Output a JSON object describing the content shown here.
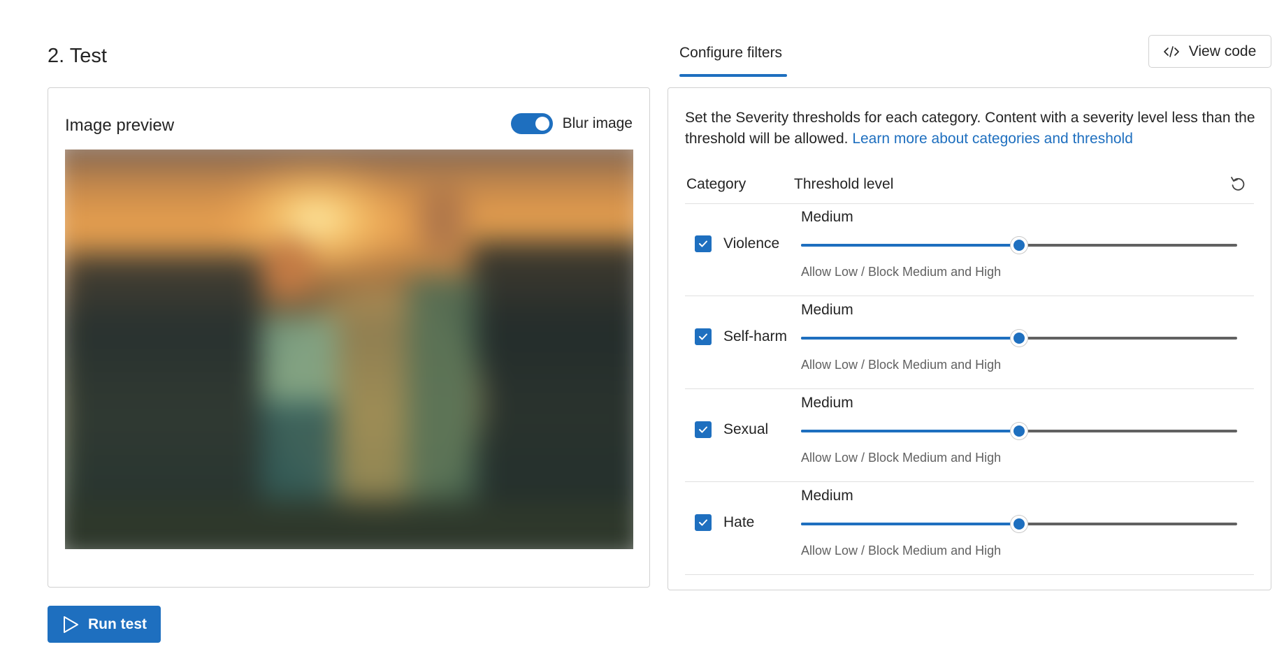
{
  "section": {
    "title": "2. Test"
  },
  "preview": {
    "title": "Image preview",
    "blur_label": "Blur image",
    "blur_enabled": true
  },
  "tabs": [
    {
      "label": "Configure filters",
      "selected": true
    }
  ],
  "view_code_label": "View code",
  "filters": {
    "description": "Set the Severity thresholds for each category. Content with a severity level less than the threshold will be allowed.",
    "learn_more_link": "Learn more about categories and threshold",
    "header": {
      "category": "Category",
      "threshold": "Threshold level"
    },
    "rows": [
      {
        "category": "Violence",
        "checked": true,
        "level": "Medium",
        "hint": "Allow Low / Block Medium and High",
        "value_fraction": 0.5
      },
      {
        "category": "Self-harm",
        "checked": true,
        "level": "Medium",
        "hint": "Allow Low / Block Medium and High",
        "value_fraction": 0.5
      },
      {
        "category": "Sexual",
        "checked": true,
        "level": "Medium",
        "hint": "Allow Low / Block Medium and High",
        "value_fraction": 0.5
      },
      {
        "category": "Hate",
        "checked": true,
        "level": "Medium",
        "hint": "Allow Low / Block Medium and High",
        "value_fraction": 0.5
      }
    ]
  },
  "run_test_label": "Run test",
  "colors": {
    "accent": "#1e6fbf",
    "rail": "#616161",
    "border": "#d1d1d1"
  }
}
